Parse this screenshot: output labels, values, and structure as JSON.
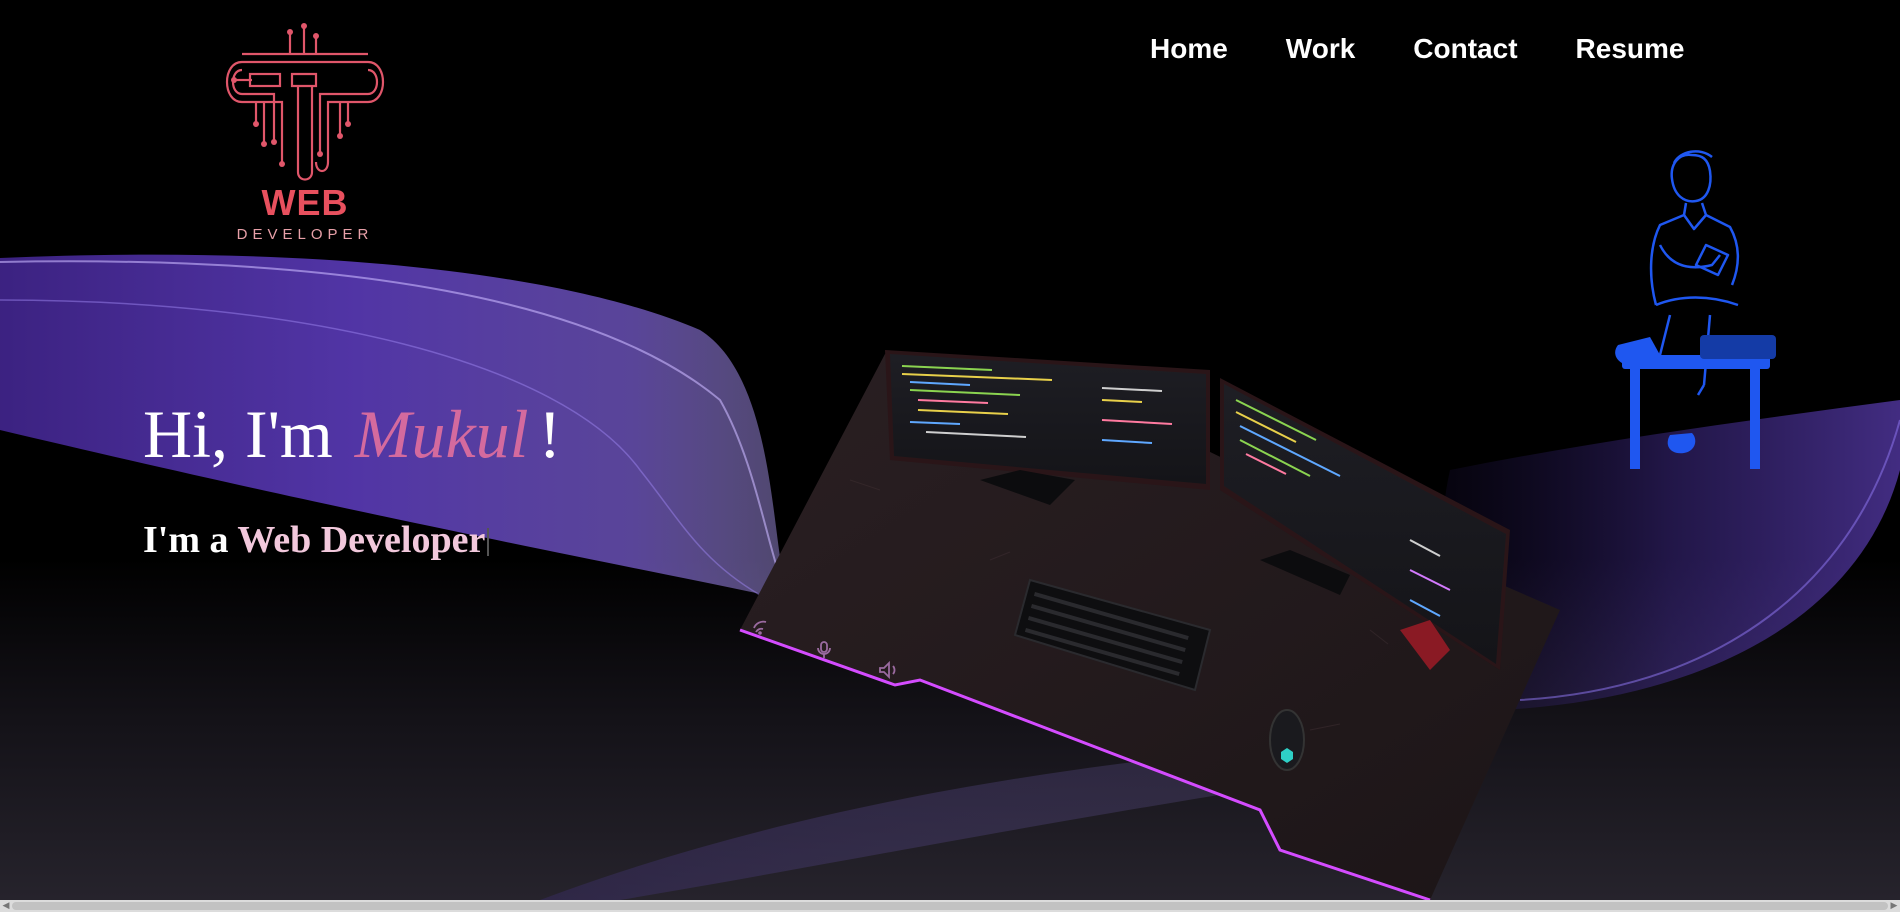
{
  "logo": {
    "word": "WEB",
    "tagline": "DEVELOPER"
  },
  "nav": {
    "home": "Home",
    "work": "Work",
    "contact": "Contact",
    "resume": "Resume"
  },
  "hero": {
    "greeting": "Hi, I'm",
    "name": "Mukul",
    "exclaim": "!",
    "prefix": "I'm a",
    "role": "Web Developer"
  },
  "colors": {
    "accent_pink": "#d46a9e",
    "logo_red": "#e8505e",
    "wave_purple": "#6a3fd0",
    "desk_edge": "#d44cff",
    "person_blue": "#1f57f0"
  },
  "icons": {
    "desk_left": "wifi-icon",
    "desk_middle": "microphone-icon",
    "desk_right": "speaker-icon"
  }
}
